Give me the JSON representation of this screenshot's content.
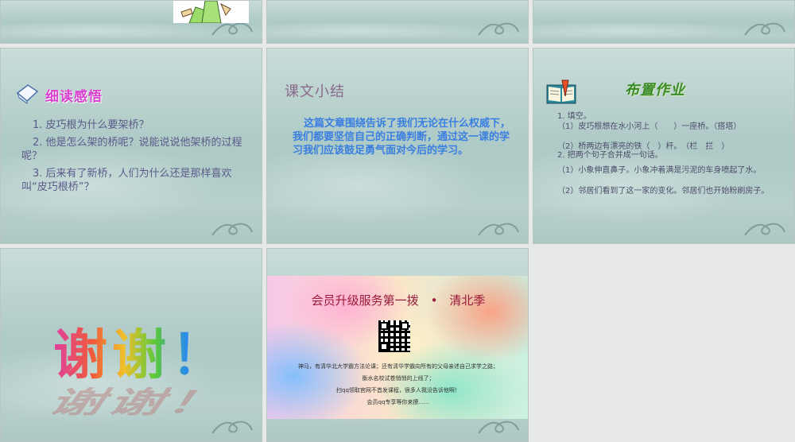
{
  "slides": {
    "s4": {
      "title": "细读感悟",
      "q1": "1. 皮巧根为什么要架桥？",
      "q2": "2. 他是怎么架的桥呢？说能说说他架桥的过程呢？",
      "q3": "3. 后来有了新桥，人们为什么还是那样喜欢叫“皮巧根桥”？"
    },
    "s5": {
      "title": "课文小结",
      "body": "这篇文章围绕告诉了我们无论在什么权威下，我们都要坚信自己的正确判断，通过这一课的学习我们应该鼓足勇气面对今后的学习。"
    },
    "s6": {
      "title": "布置作业",
      "l1": "1. 填空。",
      "l2": "（1）皮巧根想在水小河上（　　）一座桥。（搭塔）",
      "l3": "（2）桥两边有漂亮的铁（　）杆。　（栏　拦　）",
      "l4": "2. 把两个句子合并成一句话。",
      "l5": "（1）小象伸直鼻子。小象冲着满是污泥的车身喷起了水。",
      "l6": "（2）邻居们看到了这一家的变化。邻居们也开始粉刷房子。"
    },
    "s7": {
      "thanks": "谢谢！"
    },
    "s8": {
      "headline": "会员升级服务第一拨　•　清北季",
      "p1": "神马，有清华北大学霸方法论课；还有清华学霸向所有的父母亲述自己求学之路；",
      "p2": "衡水名校试卷悄悄的上线了；",
      "p3": "扫qq领取官网不首发课程，很多人我没告诉他啊！",
      "p4": "会员qq专享等你来撩……"
    }
  },
  "colors": {
    "s4_title": "#d83fcf",
    "s5_title": "#8a6a8a",
    "s5_body": "#3a7fe0",
    "s6_title": "#3a8a2a",
    "s8_headline": "#9a1a3a"
  }
}
